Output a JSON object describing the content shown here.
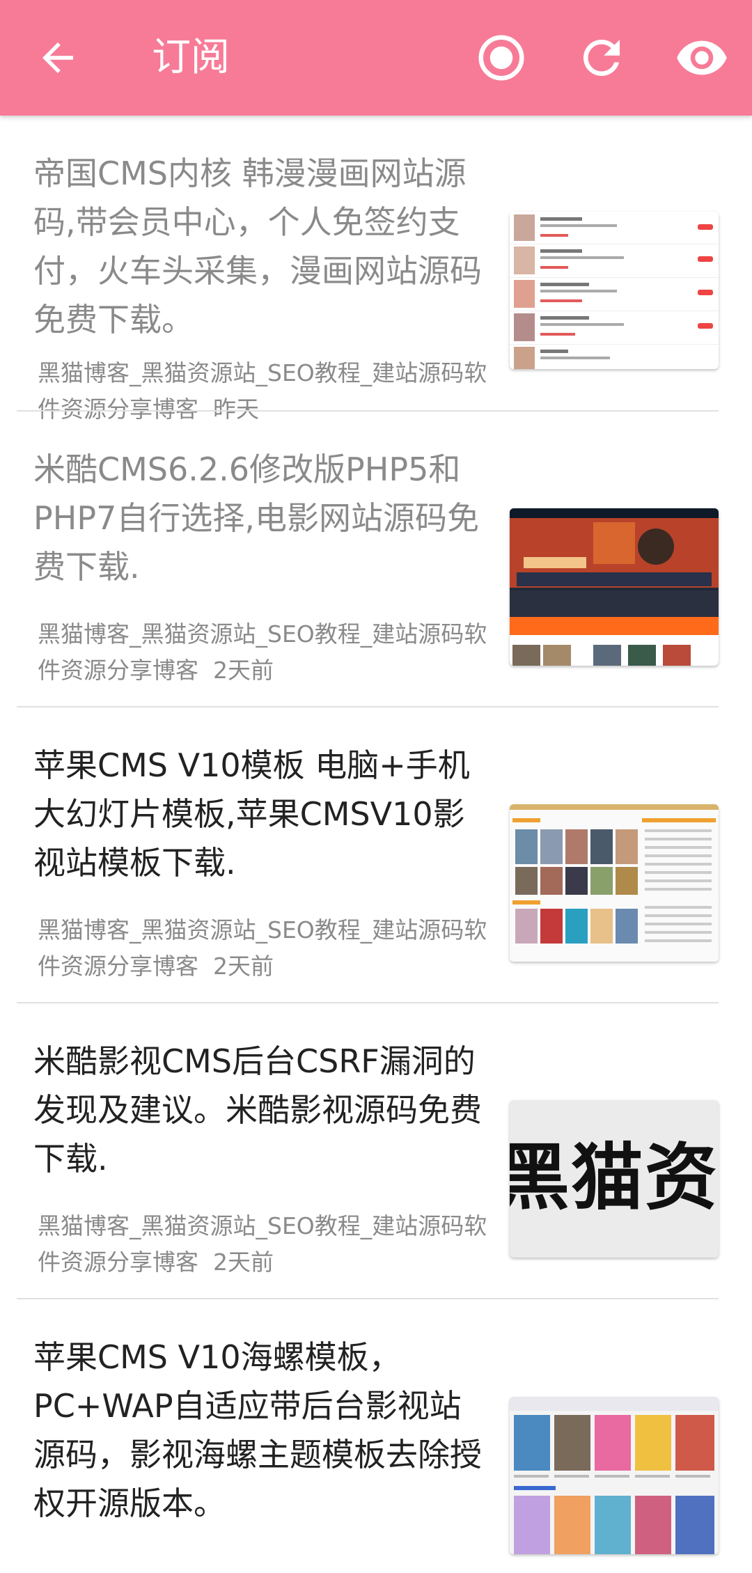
{
  "header": {
    "title": "订阅",
    "colors": {
      "bar": "#f77b97",
      "icon": "#ffffff"
    },
    "icons": [
      "back-arrow-icon",
      "record-icon",
      "refresh-icon",
      "eye-icon"
    ]
  },
  "articles": [
    {
      "title": "帝国CMS内核 韩漫漫画网站源码,带会员中心，个人免签约支付，火车头采集，漫画网站源码免费下载。",
      "source": "黑猫博客_黑猫资源站_SEO教程_建站源码软件资源分享博客",
      "time": "昨天",
      "read": true,
      "thumb_icon": "comic-site-screenshot"
    },
    {
      "title": "米酷CMS6.2.6修改版PHP5和PHP7自行选择,电影网站源码免费下载.",
      "source": "黑猫博客_黑猫资源站_SEO教程_建站源码软件资源分享博客",
      "time": "2天前",
      "read": true,
      "thumb_icon": "movie-site-screenshot"
    },
    {
      "title": "苹果CMS V10模板 电脑+手机大幻灯片模板,苹果CMSV10影视站模板下载.",
      "source": "黑猫博客_黑猫资源站_SEO教程_建站源码软件资源分享博客",
      "time": "2天前",
      "read": false,
      "thumb_icon": "video-grid-screenshot"
    },
    {
      "title": "米酷影视CMS后台CSRF漏洞的发现及建议。米酷影视源码免费下载.",
      "source": "黑猫博客_黑猫资源站_SEO教程_建站源码软件资源分享博客",
      "time": "2天前",
      "read": false,
      "thumb_text": "黑猫资源"
    },
    {
      "title": "苹果CMS V10海螺模板，PC+WAP自适应带后台影视站源码，影视海螺主题模板去除授权开源版本。",
      "source": "",
      "time": "",
      "read": false,
      "thumb_icon": "poster-grid-screenshot"
    }
  ]
}
